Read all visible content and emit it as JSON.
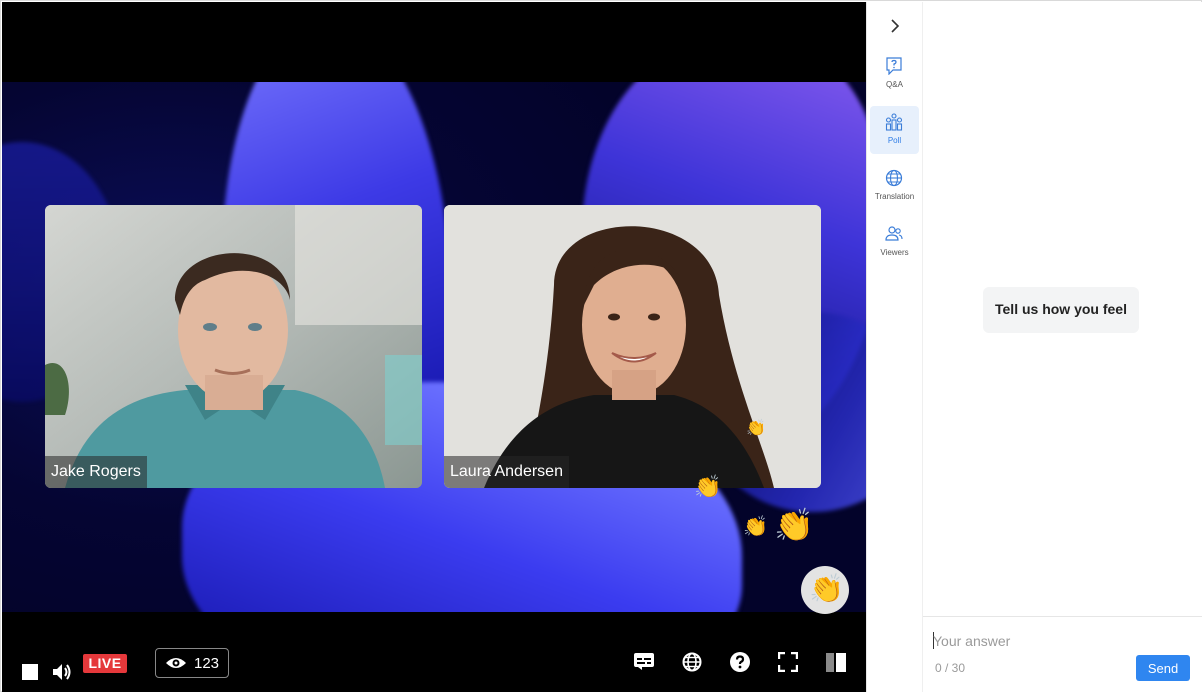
{
  "video": {
    "participants": [
      {
        "name": "Jake Rogers"
      },
      {
        "name": "Laura Andersen"
      }
    ],
    "live_label": "LIVE",
    "viewer_count": "123"
  },
  "rail": {
    "items": [
      {
        "label": "Q&A",
        "icon": "question-icon"
      },
      {
        "label": "Poll",
        "icon": "poll-icon",
        "active": true
      },
      {
        "label": "Translation",
        "icon": "globe-icon"
      },
      {
        "label": "Viewers",
        "icon": "viewers-icon"
      }
    ]
  },
  "panel": {
    "prompt": "Tell us how you feel",
    "answer_placeholder": "Your answer",
    "counter": "0 / 30",
    "send_label": "Send"
  },
  "colors": {
    "live": "#e5383b",
    "accent": "#2f86f0",
    "rail_active_bg": "#e7f0fc"
  }
}
